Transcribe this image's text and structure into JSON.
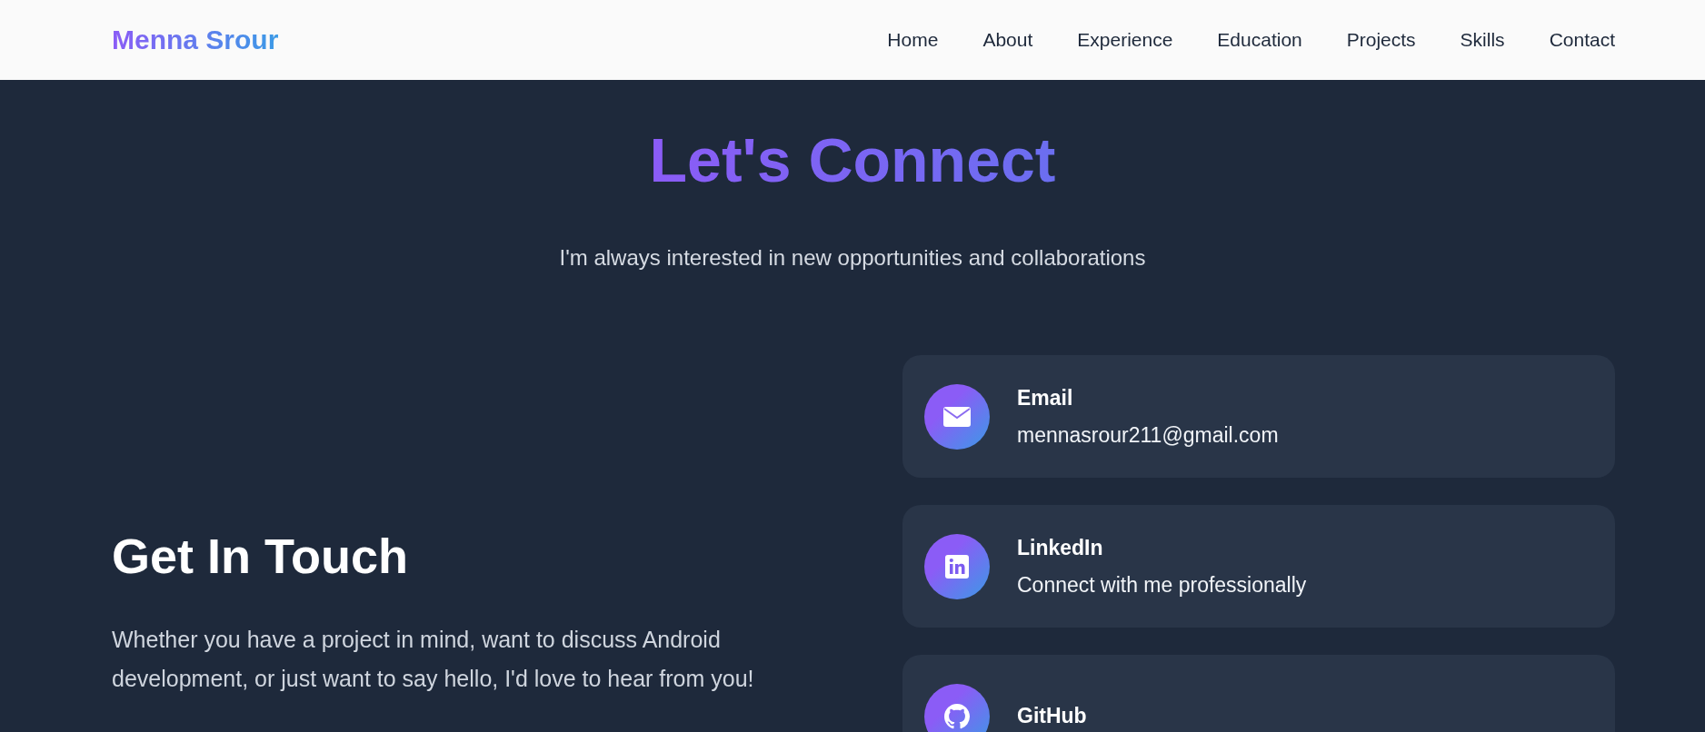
{
  "header": {
    "logo": "Menna Srour",
    "nav": [
      {
        "label": "Home"
      },
      {
        "label": "About"
      },
      {
        "label": "Experience"
      },
      {
        "label": "Education"
      },
      {
        "label": "Projects"
      },
      {
        "label": "Skills"
      },
      {
        "label": "Contact"
      }
    ]
  },
  "section": {
    "title": "Let's Connect",
    "subtitle": "I'm always interested in new opportunities and collaborations"
  },
  "intro": {
    "heading": "Get In Touch",
    "text": "Whether you have a project in mind, want to discuss Android development, or just want to say hello, I'd love to hear from you!"
  },
  "contacts": [
    {
      "kind": "email",
      "title": "Email",
      "detail": "mennasrour211@gmail.com"
    },
    {
      "kind": "linkedin",
      "title": "LinkedIn",
      "detail": "Connect with me professionally"
    },
    {
      "kind": "github",
      "title": "GitHub"
    }
  ]
}
